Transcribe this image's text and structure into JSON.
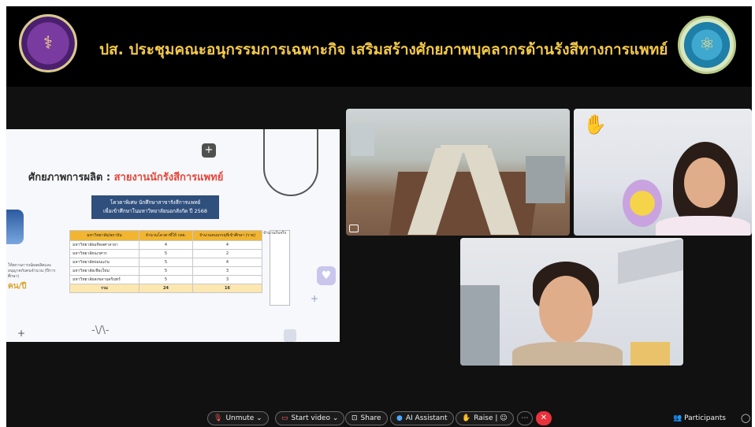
{
  "banner": {
    "title": "ปส. ประชุมคณะอนุกรรมการเฉพาะกิจ เสริมสร้างศักยภาพบุคลากรด้านรังสีทางการแพทย์",
    "title_color": "#f3c94a"
  },
  "slide": {
    "heading_prefix": "ศักยภาพการผลิต : ",
    "heading_highlight": "สายงานนักรังสีการแพทย์",
    "table_title_line1": "โควตาพิเศษ นักศึกษาสาขารังสีการแพทย์",
    "table_title_line2": "เพื่อเข้าศึกษาในมหาวิทยาลัยนอกสังกัด ปี 2568",
    "side_label": "จำนวนรับจริง",
    "left_note": "ให้สถานการณ์ผลผลิตและ อนุญาตกับคนจำนวน (ปีการศึกษา)",
    "left_big": "คน/ปี",
    "table": {
      "headers": [
        "มหาวิทยาลัย/สถาบัน",
        "จำนวนโควตาที่ให้ กสธ.",
        "จำนวนคนบรรจุที่เข้าศึกษา (ราย)"
      ],
      "rows": [
        [
          "มหาวิทยาลัยมหิดลศาลายา",
          "4",
          "4"
        ],
        [
          "มหาวิทยาลัยนเรศวร",
          "5",
          "2"
        ],
        [
          "มหาวิทยาลัยขอนแก่น",
          "5",
          "4"
        ],
        [
          "มหาวิทยาลัยเชียงใหม่",
          "5",
          "3"
        ],
        [
          "มหาวิทยาลัยสงขลานครินทร์",
          "5",
          "3"
        ]
      ],
      "total": [
        "รวม",
        "24",
        "16"
      ]
    }
  },
  "tiles": {
    "room": "meeting-room-video",
    "woman1": "participant-video-raised-hand",
    "woman2": "participant-video"
  },
  "toolbar": {
    "unmute": "Unmute",
    "start_video": "Start video",
    "share": "Share",
    "ai_assistant": "AI Assistant",
    "raise": "Raise",
    "participants": "Participants"
  },
  "colors": {
    "background": "#111111",
    "end_button": "#e8323c",
    "slide_table_header": "#f2b531",
    "slide_title_box": "#2f4f7d"
  }
}
